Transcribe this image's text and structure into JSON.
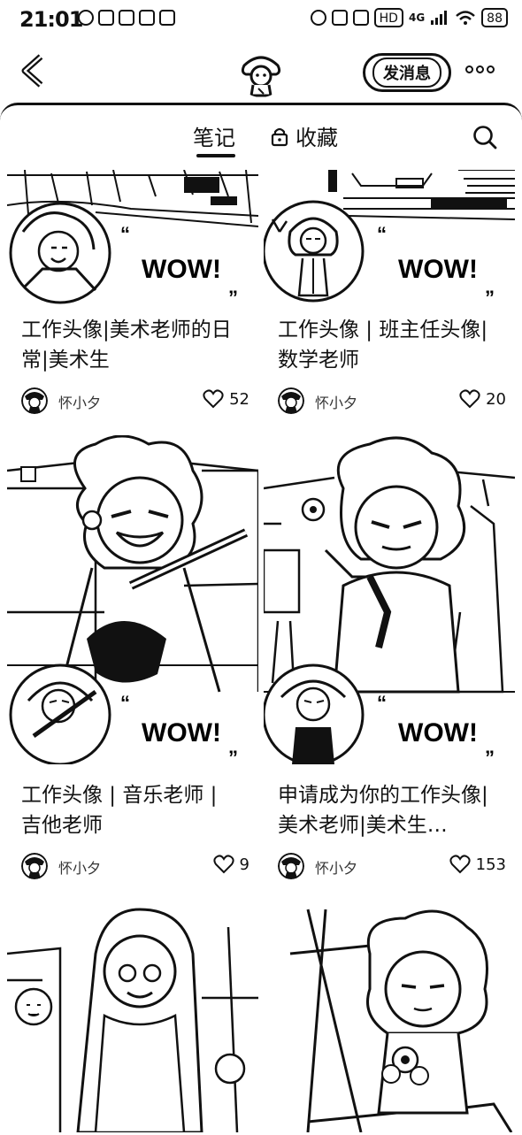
{
  "status_bar": {
    "time": "21:01",
    "network": "4G",
    "hd": "HD",
    "battery": "88"
  },
  "header": {
    "follow_label": "发消息"
  },
  "tabs": {
    "notes": "笔记",
    "favorites": "收藏"
  },
  "badges": {
    "wow": "WOW!"
  },
  "cards": [
    {
      "title": "工作头像|美术老师的日常|美术生",
      "author": "怀小夕",
      "likes": "52"
    },
    {
      "title": "工作头像 | 班主任头像|数学老师",
      "author": "怀小夕",
      "likes": "20"
    },
    {
      "title": "工作头像 | 音乐老师 | 吉他老师",
      "author": "怀小夕",
      "likes": "9"
    },
    {
      "title": "申请成为你的工作头像|美术老师|美术生…",
      "author": "怀小夕",
      "likes": "153"
    }
  ],
  "icons": [
    "back-arrow-icon",
    "more-dots-icon",
    "lock-icon",
    "search-icon",
    "heart-icon"
  ]
}
